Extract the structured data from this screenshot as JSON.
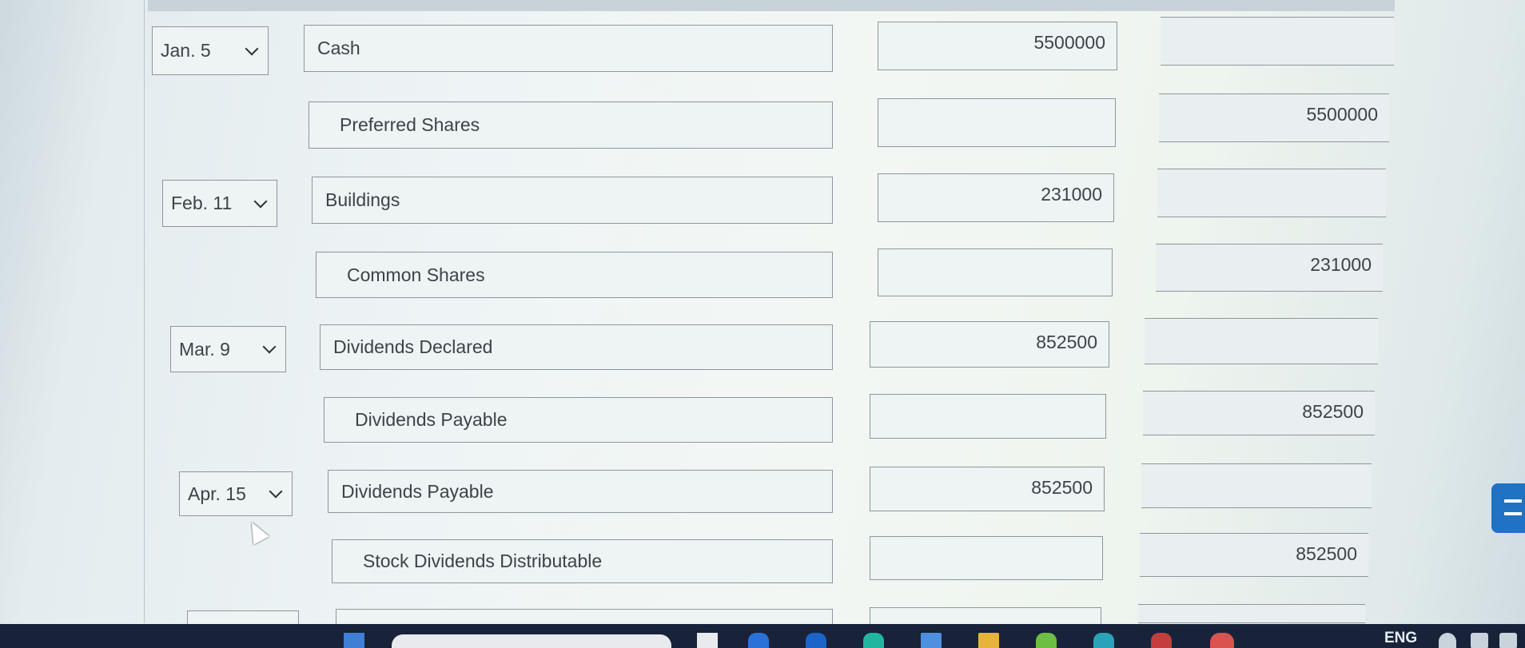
{
  "journal": {
    "rows": [
      {
        "date": "Jan. 5",
        "account": "Cash",
        "debit": "5500000",
        "credit": ""
      },
      {
        "date": "",
        "account": "Preferred Shares",
        "debit": "",
        "credit": "5500000"
      },
      {
        "date": "Feb. 11",
        "account": "Buildings",
        "debit": "231000",
        "credit": ""
      },
      {
        "date": "",
        "account": "Common Shares",
        "debit": "",
        "credit": "231000"
      },
      {
        "date": "Mar. 9",
        "account": "Dividends Declared",
        "debit": "852500",
        "credit": ""
      },
      {
        "date": "",
        "account": "Dividends Payable",
        "debit": "",
        "credit": "852500"
      },
      {
        "date": "Apr. 15",
        "account": "Dividends Payable",
        "debit": "852500",
        "credit": ""
      },
      {
        "date": "",
        "account": "Stock Dividends Distributable",
        "debit": "",
        "credit": "852500"
      }
    ]
  },
  "taskbar": {
    "language": "ENG"
  },
  "colors": {
    "taskbar": "#18233a",
    "field_border": "#8d979c",
    "side_tab": "#1f72c4"
  }
}
